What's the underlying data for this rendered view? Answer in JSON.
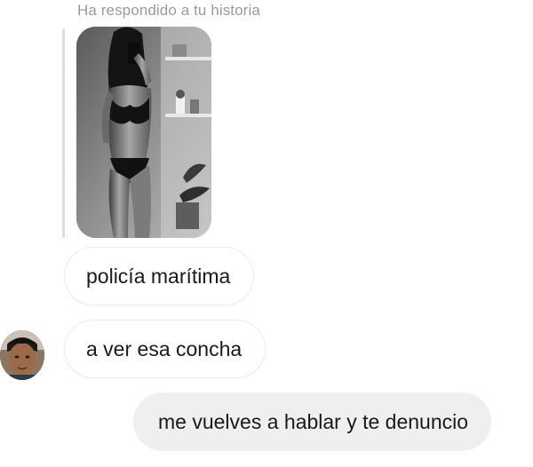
{
  "story": {
    "reply_label": "Ha respondido a tu historia",
    "thumbnail_icon": "story-photo"
  },
  "messages": [
    {
      "sender": "other",
      "text": "policía marítima"
    },
    {
      "sender": "other",
      "text": "a ver esa concha"
    },
    {
      "sender": "me",
      "text": "me vuelves a hablar y te denuncio"
    }
  ],
  "colors": {
    "incoming_bubble": "#ffffff",
    "outgoing_bubble": "#efefef",
    "label_text": "#9a9a9a",
    "message_text": "#1a1a1a"
  }
}
